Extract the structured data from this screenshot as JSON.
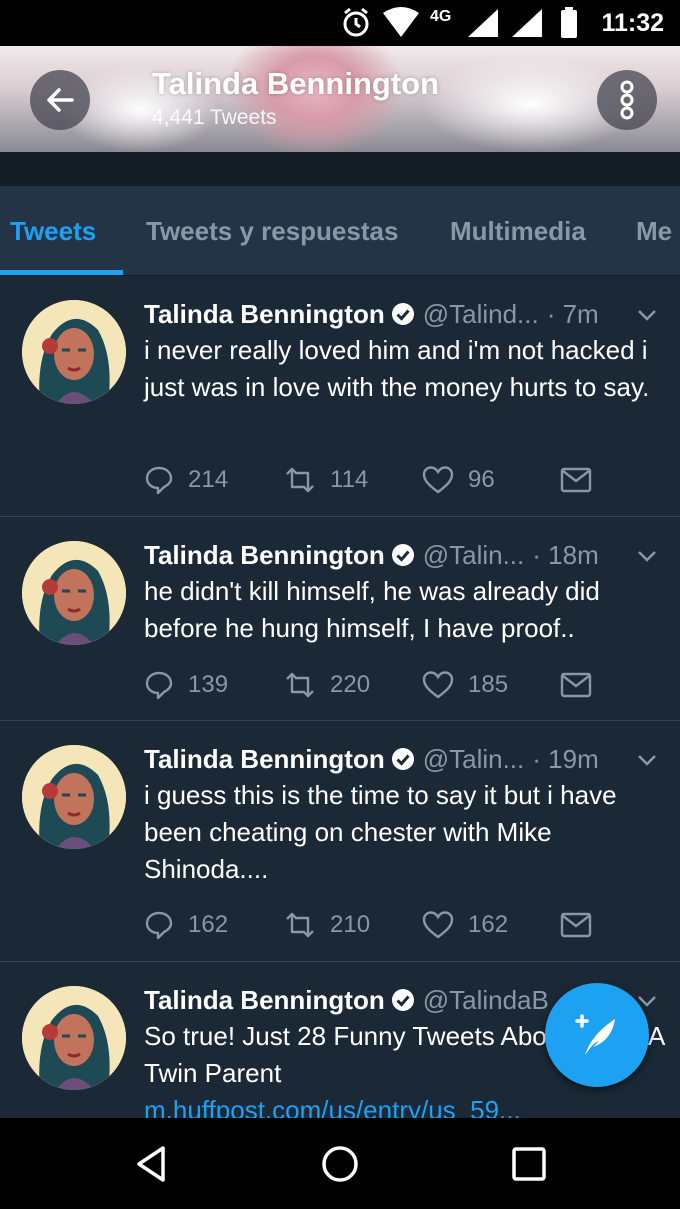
{
  "status_bar": {
    "time": "11:32",
    "network": "4G"
  },
  "header": {
    "title": "Talinda Bennington",
    "subtitle": "4,441 Tweets"
  },
  "tabs": [
    {
      "label": "Tweets",
      "active": true
    },
    {
      "label": "Tweets y respuestas",
      "active": false
    },
    {
      "label": "Multimedia",
      "active": false
    },
    {
      "label": "Me",
      "active": false
    }
  ],
  "tweets": [
    {
      "name": "Talinda Bennington",
      "handle": "@Talind...",
      "time": "· 7m",
      "text": "i never really loved him and i'm not hacked i just was in love with the money hurts to say.",
      "replies": "214",
      "retweets": "114",
      "likes": "96"
    },
    {
      "name": "Talinda Bennington",
      "handle": "@Talin...",
      "time": "· 18m",
      "text": "he didn't kill himself, he was already did before he hung himself, I have proof..",
      "replies": "139",
      "retweets": "220",
      "likes": "185"
    },
    {
      "name": "Talinda Bennington",
      "handle": "@Talin...",
      "time": "· 19m",
      "text": "i guess this is the time to say it but i have been cheating on chester with Mike Shinoda....",
      "replies": "162",
      "retweets": "210",
      "likes": "162"
    },
    {
      "name": "Talinda Bennington",
      "handle": "@TalindaB",
      "time": "",
      "text": "So true! Just 28 Funny Tweets About Being A Twin Parent ",
      "link": "m.huffpost.com/us/entry/us_59..."
    }
  ],
  "colors": {
    "accent": "#1da1f2",
    "background": "#1b2836",
    "tab_bar": "#243447",
    "muted": "#8899a6"
  },
  "icons": {
    "back": "arrow-left-icon",
    "more": "more-vertical-icon",
    "reply": "reply-icon",
    "retweet": "retweet-icon",
    "like": "heart-icon",
    "dm": "envelope-icon",
    "compose": "compose-tweet-icon"
  }
}
